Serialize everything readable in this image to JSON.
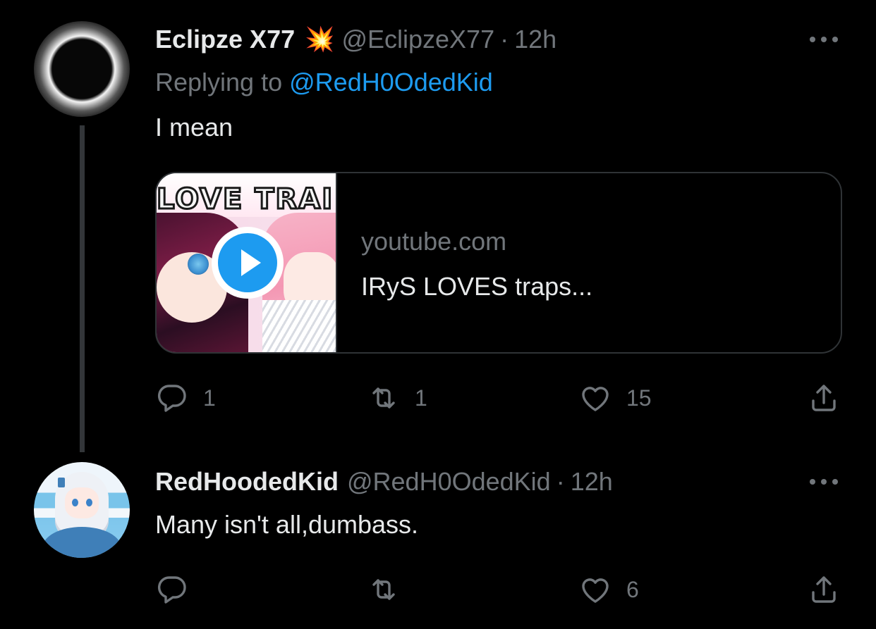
{
  "tweets": [
    {
      "display_name": "Eclipze X77",
      "badge_icon": "collision-emoji-icon",
      "badge_glyph": "💥",
      "handle": "@EclipzeX77",
      "separator": "·",
      "time": "12h",
      "replying_prefix": "Replying to",
      "replying_to": "@RedH0OdedKid",
      "text": "I mean",
      "card": {
        "thumbnail_text": "LOVE TRAI",
        "domain": "youtube.com",
        "title": "IRyS LOVES traps..."
      },
      "counts": {
        "replies": "1",
        "retweets": "1",
        "likes": "15"
      }
    },
    {
      "display_name": "RedHoodedKid",
      "handle": "@RedH0OdedKid",
      "separator": "·",
      "time": "12h",
      "text": "Many isn't all,dumbass.",
      "counts": {
        "replies": "",
        "retweets": "",
        "likes": "6"
      }
    }
  ],
  "colors": {
    "background": "#000000",
    "primary_text": "#e7e9ea",
    "secondary_text": "#71767b",
    "accent": "#1d9bf0",
    "border": "#2f3336"
  }
}
